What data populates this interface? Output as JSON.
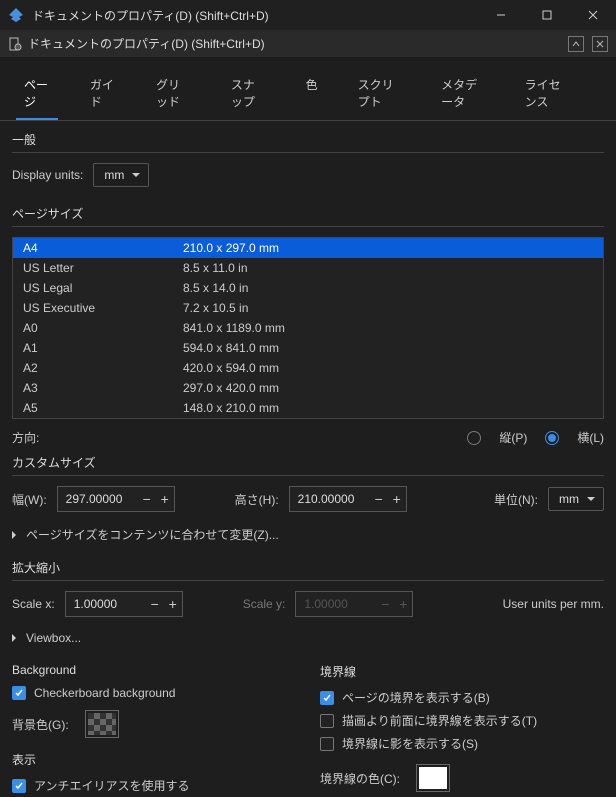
{
  "window": {
    "title": "ドキュメントのプロパティ(D) (Shift+Ctrl+D)",
    "subtitle": "ドキュメントのプロパティ(D) (Shift+Ctrl+D)"
  },
  "tabs": [
    "ページ",
    "ガイド",
    "グリッド",
    "スナップ",
    "色",
    "スクリプト",
    "メタデータ",
    "ライセンス"
  ],
  "general": {
    "heading": "一般",
    "display_units_label": "Display units:",
    "display_units_value": "mm"
  },
  "page_size": {
    "heading": "ページサイズ",
    "rows": [
      {
        "name": "A4",
        "dim": "210.0 x 297.0 mm",
        "selected": true
      },
      {
        "name": "US Letter",
        "dim": "8.5 x 11.0 in"
      },
      {
        "name": "US Legal",
        "dim": "8.5 x 14.0 in"
      },
      {
        "name": "US Executive",
        "dim": "7.2 x 10.5 in"
      },
      {
        "name": "A0",
        "dim": "841.0 x 1189.0 mm"
      },
      {
        "name": "A1",
        "dim": "594.0 x 841.0 mm"
      },
      {
        "name": "A2",
        "dim": "420.0 x 594.0 mm"
      },
      {
        "name": "A3",
        "dim": "297.0 x 420.0 mm"
      },
      {
        "name": "A5",
        "dim": "148.0 x 210.0 mm"
      }
    ]
  },
  "orientation": {
    "label": "方向:",
    "portrait": "縦(P)",
    "landscape": "横(L)"
  },
  "custom_size": {
    "heading": "カスタムサイズ",
    "width_label": "幅(W):",
    "width_value": "297.00000",
    "height_label": "高さ(H):",
    "height_value": "210.00000",
    "units_label": "単位(N):",
    "units_value": "mm",
    "resize_label": "ページサイズをコンテンツに合わせて変更(Z)..."
  },
  "scale": {
    "heading": "拡大縮小",
    "scalex_label": "Scale x:",
    "scalex_value": "1.00000",
    "scaley_label": "Scale y:",
    "scaley_value": "1.00000",
    "note": "User units per mm.",
    "viewbox_label": "Viewbox..."
  },
  "background": {
    "heading": "Background",
    "checkerboard": "Checkerboard background",
    "bg_color_label": "背景色(G):"
  },
  "display": {
    "heading": "表示",
    "aa": "アンチエイリアスを使用する"
  },
  "border": {
    "heading": "境界線",
    "show_border": "ページの境界を表示する(B)",
    "front_border": "描画より前面に境界線を表示する(T)",
    "shadow_border": "境界線に影を表示する(S)",
    "border_color_label": "境界線の色(C):"
  }
}
